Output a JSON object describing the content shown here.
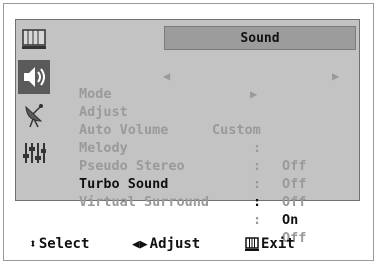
{
  "menu": {
    "title": "Sound",
    "items": [
      {
        "label": "Mode",
        "value": "Custom",
        "type": "selector"
      },
      {
        "label": "Adjust",
        "value": "",
        "type": "submenu"
      },
      {
        "label": "Auto Volume",
        "value": "Off",
        "type": "option"
      },
      {
        "label": "Melody",
        "value": "Off",
        "type": "option"
      },
      {
        "label": "Pseudo Stereo",
        "value": "Off",
        "type": "option"
      },
      {
        "label": "Turbo Sound",
        "value": "On",
        "type": "option",
        "highlighted": true
      },
      {
        "label": "Virtual Surround",
        "value": "Off",
        "type": "option"
      }
    ]
  },
  "icons": [
    {
      "name": "picture-menu-icon"
    },
    {
      "name": "sound-menu-icon",
      "active": true
    },
    {
      "name": "channel-menu-icon"
    },
    {
      "name": "setup-menu-icon"
    }
  ],
  "footer": {
    "select_label": "Select",
    "adjust_label": "Adjust",
    "exit_label": "Exit"
  },
  "colors": {
    "osd_background": "#c3c3c3",
    "header_background": "#9c9c9c",
    "active_icon_background": "#5a5a5a",
    "dim_text": "#9a9a9a",
    "highlight_text": "#111111"
  }
}
